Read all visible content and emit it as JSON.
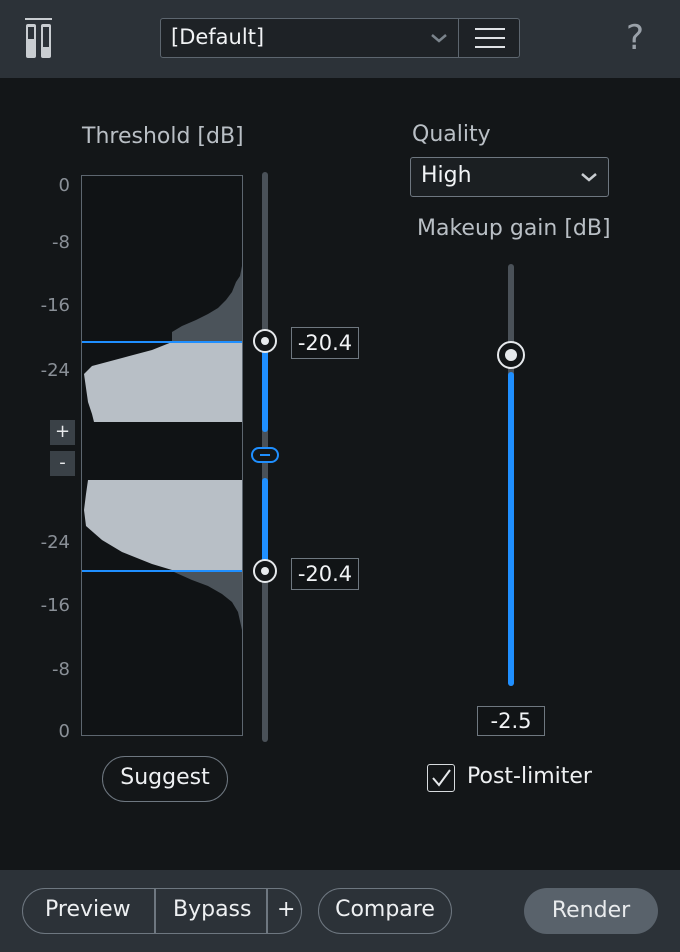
{
  "header": {
    "preset_value": "[Default]",
    "help_glyph": "?"
  },
  "threshold": {
    "label": "Threshold [dB]",
    "upper_ticks": [
      "0",
      "-8",
      "-16",
      "-24"
    ],
    "lower_ticks": [
      "-24",
      "-16",
      "-8",
      "0"
    ],
    "upper_value": "-20.4",
    "lower_value": "-20.4",
    "plus_label": "+",
    "minus_label": "-",
    "suggest_label": "Suggest"
  },
  "quality": {
    "label": "Quality",
    "value": "High"
  },
  "makeup": {
    "label": "Makeup gain [dB]",
    "value": "-2.5",
    "level": 0.21
  },
  "post_limiter": {
    "label": "Post-limiter",
    "checked": true
  },
  "footer": {
    "preview_label": "Preview",
    "bypass_label": "Bypass",
    "add_label": "+",
    "compare_label": "Compare",
    "render_label": "Render"
  },
  "colors": {
    "accent": "#1f8fff",
    "histogram_active": "#b8bfc6",
    "histogram_muted": "#4b535a"
  }
}
